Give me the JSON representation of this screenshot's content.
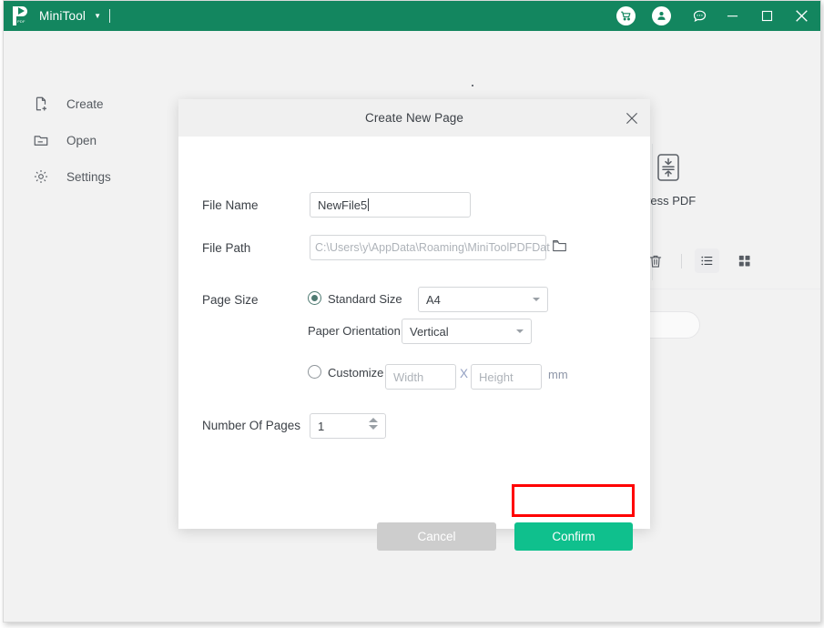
{
  "window": {
    "titlebar": {
      "logo_icon": "minitool-pdf-logo-icon",
      "logo_badge_text": "PDF",
      "brand": "MiniTool",
      "brand_caret_icon": "chevron-down-icon",
      "cart_icon": "shopping-cart-icon",
      "account_icon": "user-account-icon",
      "feedback_icon": "chat-bubble-icon",
      "minimize_icon": "minimize-icon",
      "maximize_icon": "maximize-icon",
      "close_icon": "close-icon",
      "bar_color": "#13865f"
    }
  },
  "sidebar": {
    "items": [
      {
        "label": "Create",
        "icon": "new-document-icon"
      },
      {
        "label": "Open",
        "icon": "folder-open-icon"
      },
      {
        "label": "Settings",
        "icon": "gear-icon"
      }
    ]
  },
  "background": {
    "ghost_heading": "",
    "tool_card": {
      "label": "mpress PDF",
      "icon": "compress-pdf-icon"
    },
    "toolbar": [
      {
        "name": "ocr-glasses-icon",
        "icon": "glasses-icon",
        "active": false
      },
      {
        "name": "delete-icon",
        "icon": "trash-icon",
        "active": false
      },
      {
        "name": "list-view-icon",
        "icon": "list-icon",
        "active": true
      },
      {
        "name": "grid-view-icon",
        "icon": "grid-icon",
        "active": false
      }
    ],
    "search_placeholder": ""
  },
  "dialog": {
    "title": "Create New Page",
    "close_icon": "close-icon",
    "fields": {
      "file_name": {
        "label": "File Name",
        "value": "NewFile5",
        "placeholder": ""
      },
      "file_path": {
        "label": "File Path",
        "value": "",
        "placeholder": "C:\\Users\\y\\AppData\\Roaming\\MiniToolPDFDat",
        "browse_icon": "folder-icon"
      },
      "page_size": {
        "label": "Page Size",
        "standard_radio_label": "Standard Size",
        "standard_selected": true,
        "standard_value": "A4",
        "standard_options": [
          "A4"
        ],
        "orientation_label": "Paper Orientation",
        "orientation_value": "Vertical",
        "orientation_options": [
          "Vertical"
        ],
        "customize_radio_label": "Customize",
        "customize_selected": false,
        "width_placeholder": "Width",
        "width_value": "",
        "height_placeholder": "Height",
        "height_value": "",
        "separator": "X",
        "unit": "mm"
      },
      "number_of_pages": {
        "label": "Number Of Pages",
        "value": "1",
        "increment_icon": "caret-up-icon",
        "decrement_icon": "caret-down-icon"
      }
    },
    "buttons": {
      "cancel": "Cancel",
      "confirm": "Confirm"
    },
    "colors": {
      "confirm_bg": "#0fc08d",
      "cancel_bg": "#cdcdcd",
      "radio_accent": "#4f7a72",
      "annotation": "#ff0000"
    }
  },
  "annotation": {
    "highlight_target": "confirm-button",
    "color": "#ff0000"
  }
}
